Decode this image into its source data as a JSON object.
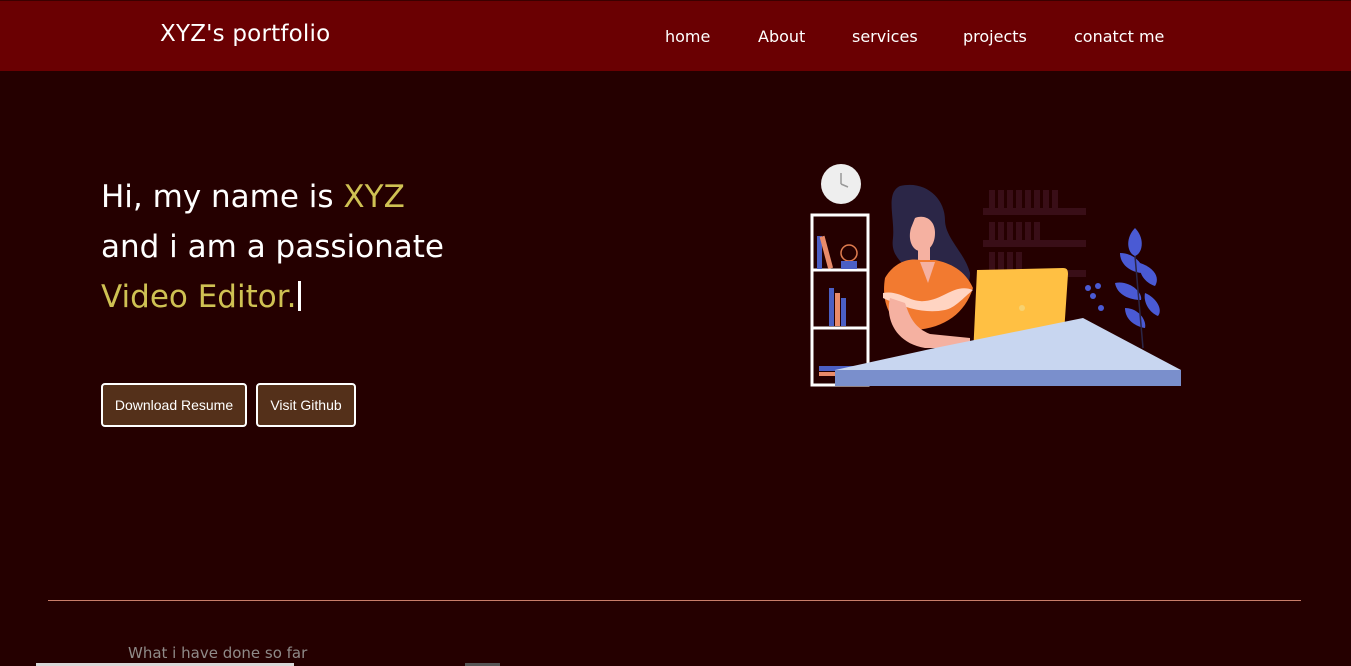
{
  "nav": {
    "brand": "XYZ's portfolio",
    "links": [
      "home",
      "About",
      "services",
      "projects",
      "conatct me"
    ]
  },
  "hero": {
    "line1_prefix": "Hi, my name is ",
    "name": "XYZ",
    "line2": "and i am a passionate",
    "role": "Video Editor."
  },
  "buttons": {
    "resume": "Download Resume",
    "github": "Visit Github"
  },
  "section": {
    "subtitle": "What i have done so far"
  },
  "colors": {
    "nav_bg": "#6a0002",
    "page_bg": "#250000",
    "accent": "#cfc153",
    "button_bg": "#54301a"
  }
}
